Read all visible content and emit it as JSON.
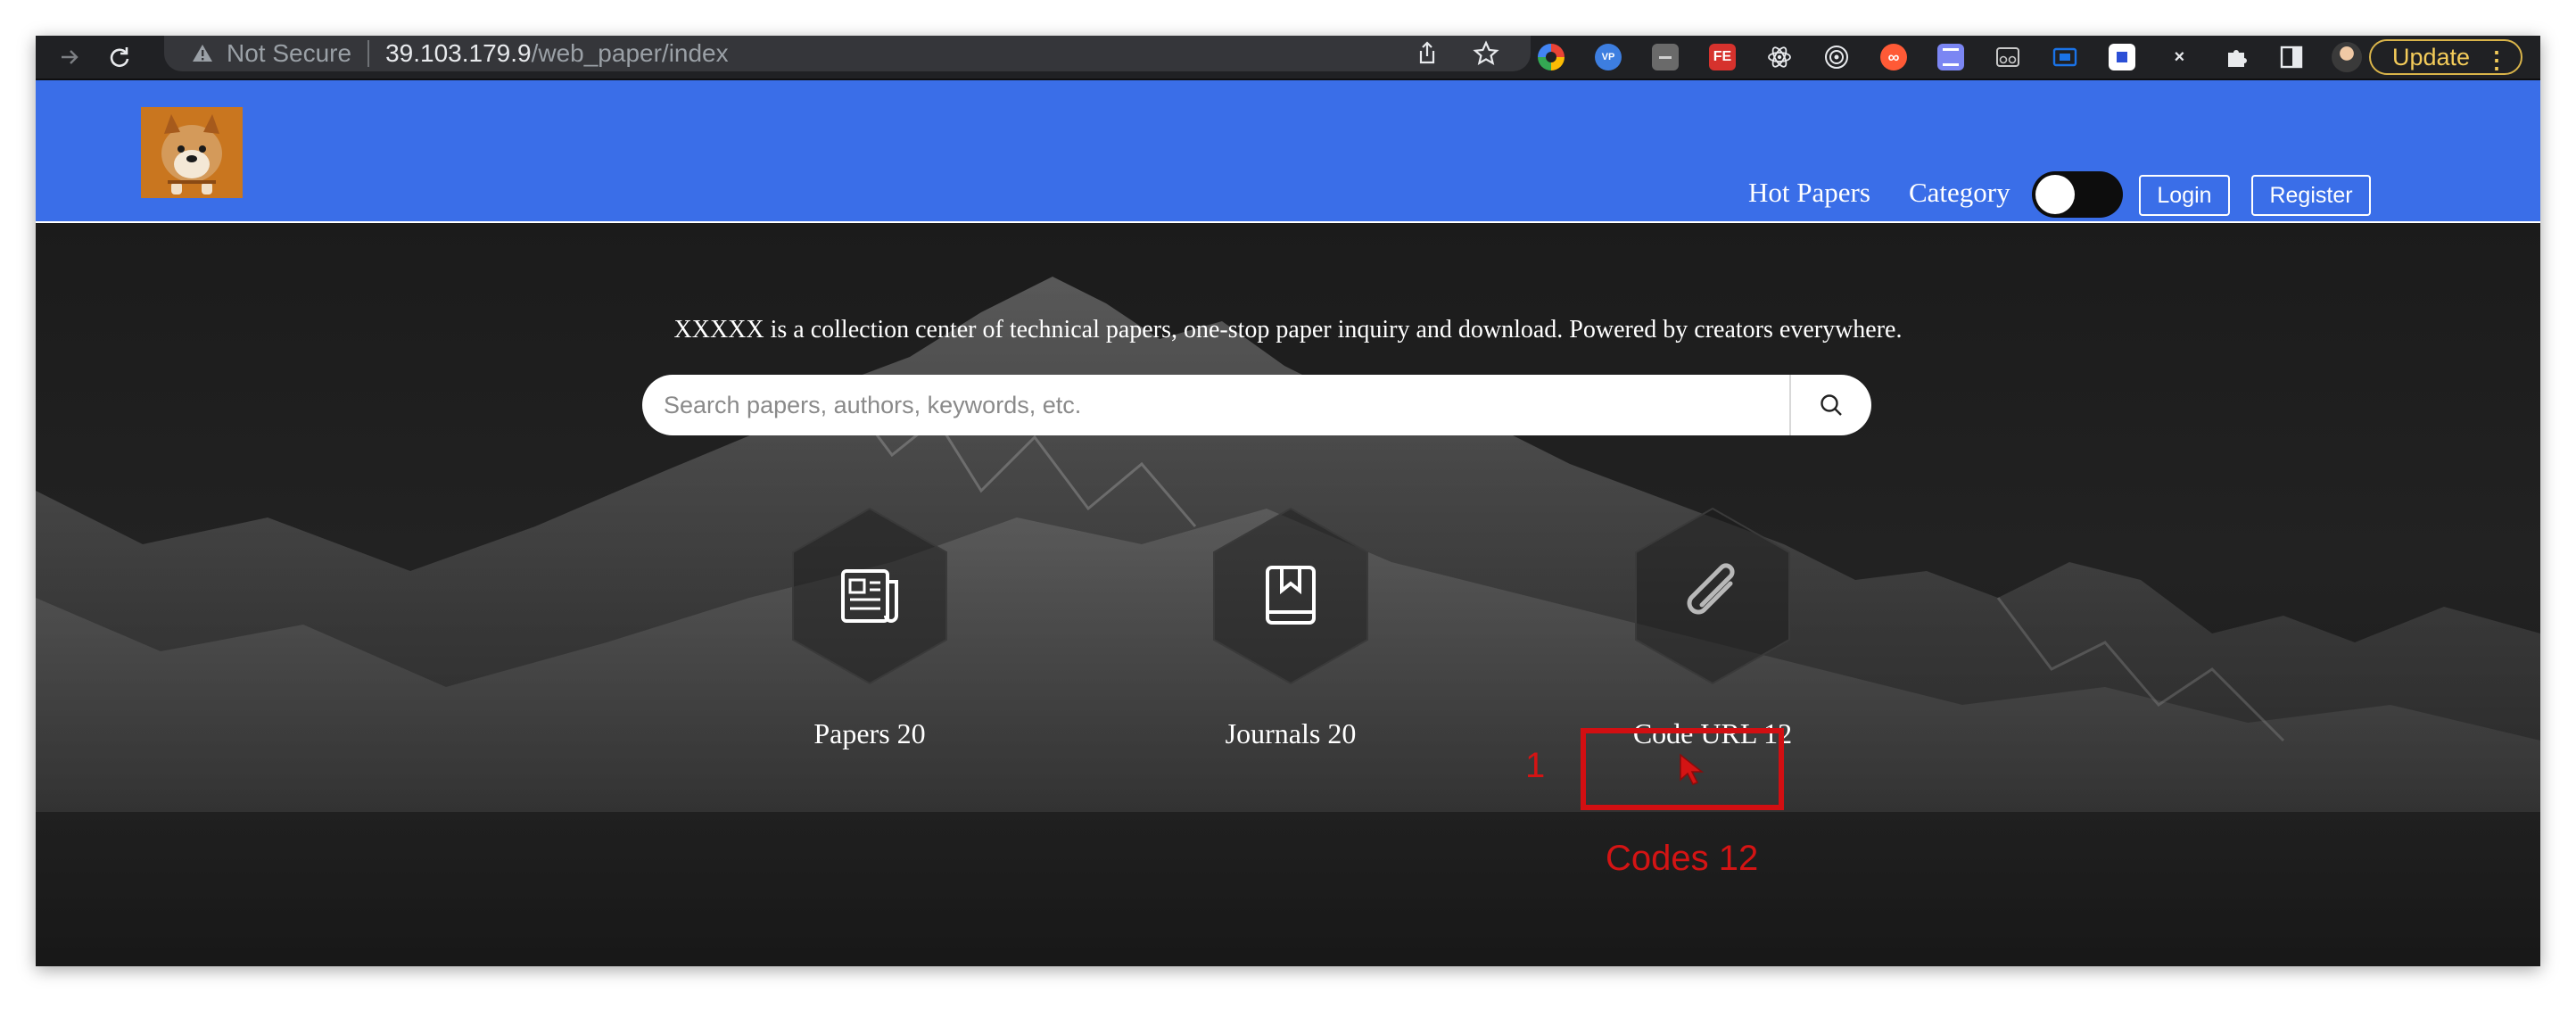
{
  "browser": {
    "security_label": "Not Secure",
    "url_host": "39.103.179.9",
    "url_path": "/web_paper/index",
    "update_label": "Update",
    "extensions": [
      "color-wheel-icon",
      "vpn-badge-icon",
      "tab-manager-icon",
      "fe-helper-icon",
      "react-devtools-icon",
      "target-icon",
      "infinity-icon",
      "storage-icon",
      "reader-icon",
      "screen-capture-icon",
      "bookmark-ext-icon",
      "x-ext-icon",
      "puzzle-icon",
      "sidebar-toggle-icon",
      "profile-avatar"
    ],
    "ext_colors": {
      "fe": "#d6322d",
      "infinity": "#ff5a36",
      "storage": "#7b86f3",
      "screen": "#1a73e8",
      "bookmark": "#ffffff"
    }
  },
  "header": {
    "nav": {
      "hot_papers": "Hot Papers",
      "category": "Category"
    },
    "login": "Login",
    "register": "Register",
    "theme_toggle_on": false,
    "colors": {
      "bar": "#3a6ee8"
    }
  },
  "hero": {
    "tagline": "XXXXX is a collection center of technical papers, one-stop paper inquiry and download. Powered by creators everywhere.",
    "search_placeholder": "Search papers, authors, keywords, etc.",
    "stats": [
      {
        "icon": "newspaper-icon",
        "label": "Papers 20"
      },
      {
        "icon": "journal-icon",
        "label": "Journals 20"
      },
      {
        "icon": "paperclip-icon",
        "label": "Code URL 12"
      }
    ]
  },
  "annotations": {
    "number": "1",
    "note": "Codes 12",
    "color": "#d20f12"
  }
}
